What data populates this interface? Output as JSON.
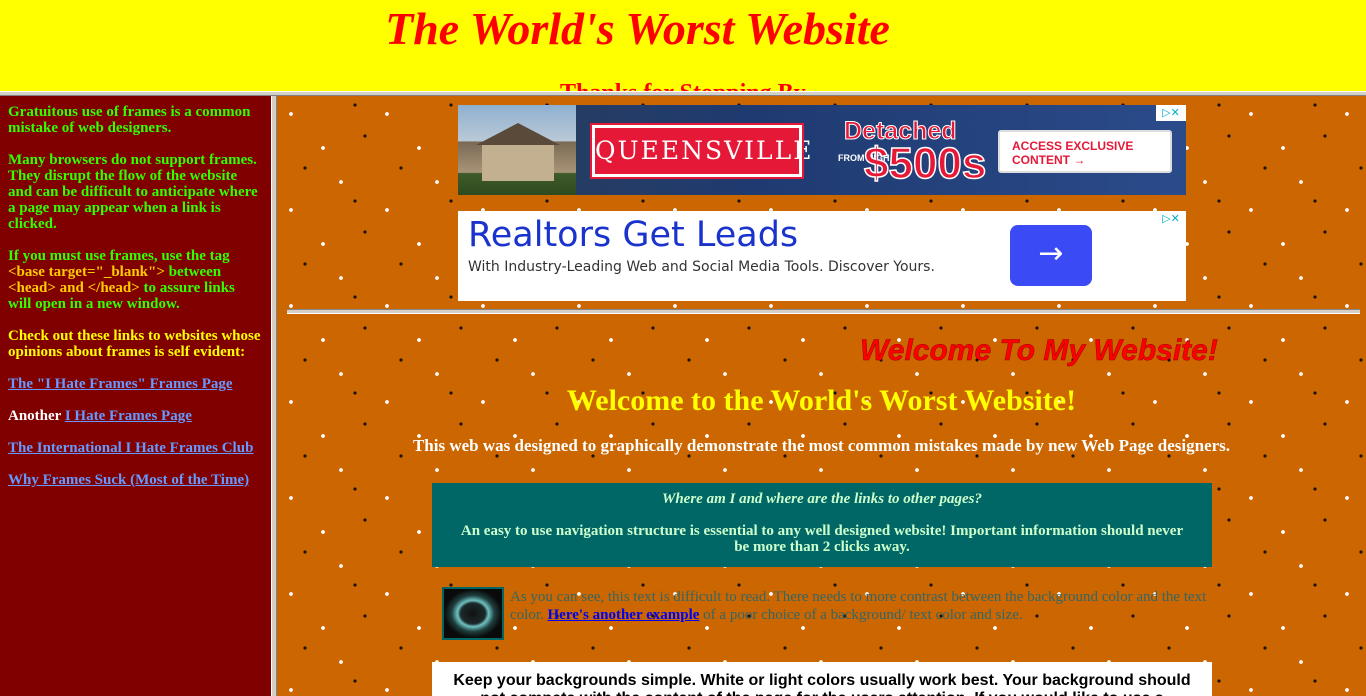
{
  "top_frame": {
    "title": "The World's Worst Website",
    "cutoff_text": "Thanks for Stopping By"
  },
  "left_frame": {
    "para1": "Gratuitous use of frames is a common mistake of web designers.",
    "para2": "Many browsers do not support frames. They disrupt the flow of the website and can be difficult to anticipate where a page may appear when a link is clicked.",
    "para3_prefix": "If you must use frames, use the tag ",
    "para3_tag1": "<base target=\"_blank\">",
    "para3_between": " between ",
    "para3_tag2": "<head> and </head>",
    "para3_suffix": " to assure links will open in a new window.",
    "para4": "Check out these links to websites whose opinions about frames is self evident:",
    "link1": "The \"I Hate Frames\" Frames Page",
    "another_label": "Another",
    "link2": "I Hate Frames Page",
    "link3": "The International I Hate Frames Club",
    "link4": "Why Frames Suck (Most of the Time)"
  },
  "ad1": {
    "brand": "QUEENSVILLE",
    "headline": "Detached",
    "from_label": "FROM HIGH",
    "price": "$500s",
    "cta": "ACCESS EXCLUSIVE CONTENT →",
    "adchoices": "▷✕"
  },
  "ad2": {
    "title": "Realtors Get Leads",
    "subtitle": "With Industry-Leading Web and Social Media Tools. Discover Yours.",
    "arrow": "→",
    "adchoices": "▷✕"
  },
  "main": {
    "marquee": "Welcome To My Website!",
    "heading": "Welcome to the World's Worst Website!",
    "subheading": "This web was designed to graphically demonstrate the most common mistakes made by new Web Page designers.",
    "nav_question": "Where am I and where are the links to other pages?",
    "nav_answer": "An easy to use navigation structure is essential to any well designed website! Important information should never be more than 2 clicks away.",
    "contrast_text": "As you can see, this text is difficult to read. There needs to more contrast between the background color and the text color.",
    "contrast_link": "Here's another example",
    "contrast_suffix": " of a poor choice of a background/ text color and size.",
    "white_box_text": "Keep your backgrounds simple. White or light colors usually work best. Your background should not compete with the content of the page for the users attention. If you would like to use a"
  },
  "colors": {
    "top_bg": "#ffff00",
    "left_bg": "#800000",
    "right_bg": "#cc6600",
    "title_red": "#ff0000",
    "nav_box": "#006666"
  }
}
